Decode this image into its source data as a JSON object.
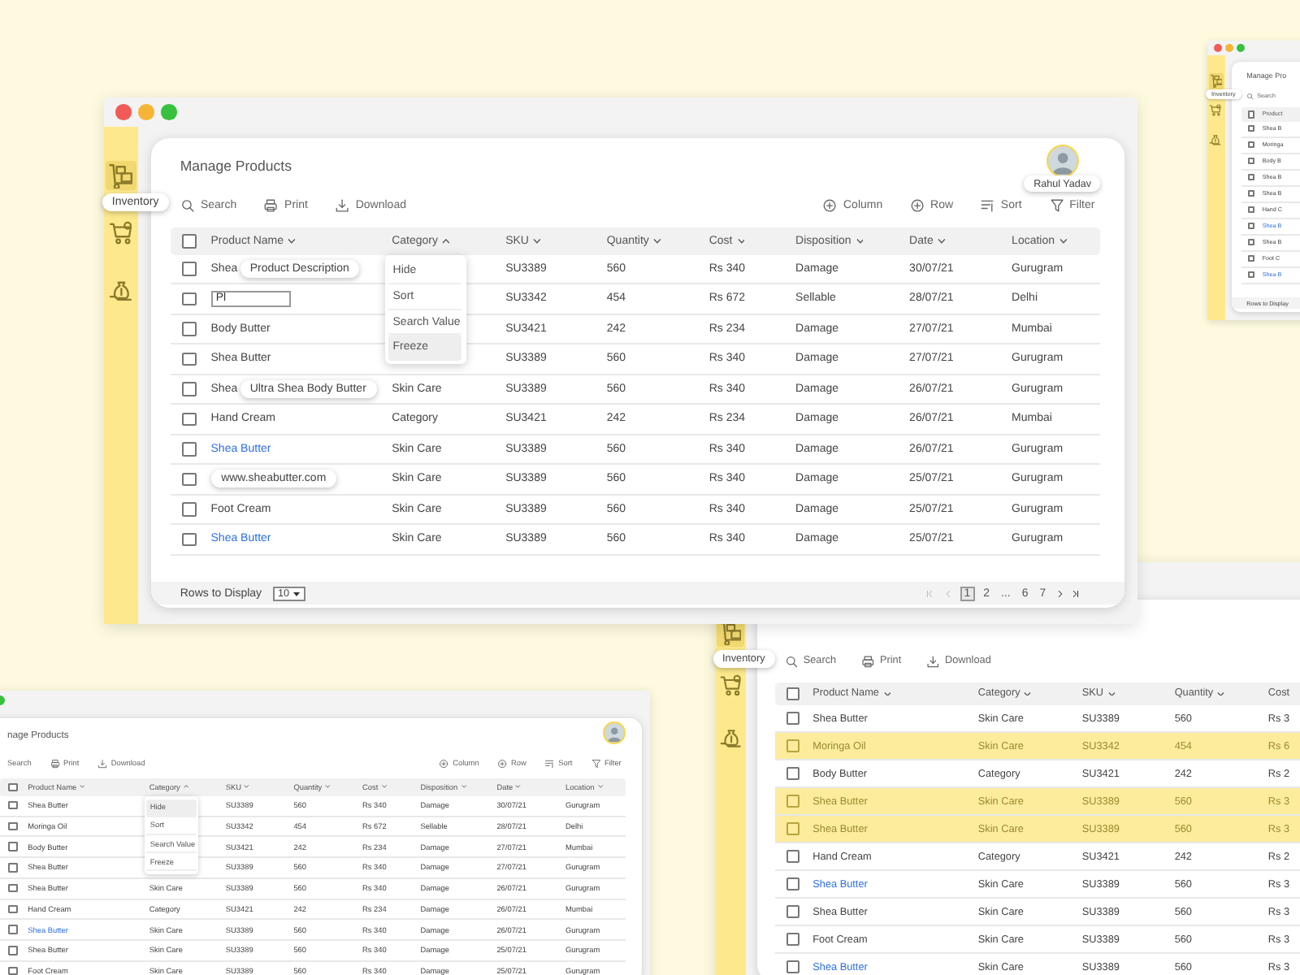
{
  "windows": [
    {
      "title": "Manage Products",
      "user_name": "Rahul Yadav",
      "header_checked": false,
      "sidebar": [
        {
          "kind": "boxes",
          "selected": true,
          "tooltip": "Inventory"
        },
        {
          "kind": "cart",
          "selected": false
        },
        {
          "kind": "money",
          "selected": false
        }
      ],
      "toolbar_left": [
        {
          "kind": "search",
          "label": "Search"
        },
        {
          "kind": "print",
          "label": "Print"
        },
        {
          "kind": "download",
          "label": "Download"
        }
      ],
      "toolbar_right": [
        {
          "kind": "column",
          "label": "Column"
        },
        {
          "kind": "row",
          "label": "Row"
        },
        {
          "kind": "sort",
          "label": "Sort"
        },
        {
          "kind": "filter",
          "label": "Filter"
        }
      ],
      "columns": [
        {
          "label": "Product Name",
          "ascending": false
        },
        {
          "label": "Category",
          "ascending": true
        },
        {
          "label": "SKU",
          "ascending": false
        },
        {
          "label": "Quantity",
          "ascending": false
        },
        {
          "label": "Cost",
          "ascending": false
        },
        {
          "label": "Disposition",
          "ascending": false
        },
        {
          "label": "Date",
          "ascending": false
        },
        {
          "label": "Location",
          "ascending": false
        }
      ],
      "menu": {
        "items": [
          {
            "label": "Hide",
            "selected": false
          },
          {
            "label": "Sort",
            "selected": false
          },
          {
            "label": "Search Value",
            "selected": false
          },
          {
            "label": "Freeze",
            "selected": true
          }
        ]
      },
      "rows": [
        {
          "selected": false,
          "product": {
            "kind": "text",
            "text": "Shea",
            "tooltip": "Product Description"
          },
          "sku": "SU3389",
          "quantity": "560",
          "cost": "Rs 340",
          "disposition": "Damage",
          "date": "30/07/21",
          "location": "Gurugram"
        },
        {
          "selected": false,
          "product": {
            "kind": "field",
            "value": "Pl"
          },
          "sku": "SU3342",
          "quantity": "454",
          "cost": "Rs 672",
          "disposition": "Sellable",
          "date": "28/07/21",
          "location": "Delhi"
        },
        {
          "selected": false,
          "product": {
            "kind": "text",
            "text": "Body Butter"
          },
          "sku": "SU3421",
          "quantity": "242",
          "cost": "Rs 234",
          "disposition": "Damage",
          "date": "27/07/21",
          "location": "Mumbai"
        },
        {
          "selected": false,
          "product": {
            "kind": "text",
            "text": "Shea Butter"
          },
          "sku": "SU3389",
          "quantity": "560",
          "cost": "Rs 340",
          "disposition": "Damage",
          "date": "27/07/21",
          "location": "Gurugram"
        },
        {
          "selected": false,
          "product": {
            "kind": "text",
            "text": "Shea",
            "tooltip": "Ultra Shea Body Butter"
          },
          "category": "Skin Care",
          "sku": "SU3389",
          "quantity": "560",
          "cost": "Rs 340",
          "disposition": "Damage",
          "date": "26/07/21",
          "location": "Gurugram"
        },
        {
          "selected": false,
          "product": {
            "kind": "text",
            "text": "Hand Cream"
          },
          "category": "Category",
          "sku": "SU3421",
          "quantity": "242",
          "cost": "Rs 234",
          "disposition": "Damage",
          "date": "26/07/21",
          "location": "Mumbai"
        },
        {
          "selected": false,
          "product": {
            "kind": "text",
            "text": "Shea Butter",
            "link": true
          },
          "category": "Skin Care",
          "sku": "SU3389",
          "quantity": "560",
          "cost": "Rs 340",
          "disposition": "Damage",
          "date": "26/07/21",
          "location": "Gurugram"
        },
        {
          "selected": false,
          "product": {
            "kind": "text",
            "tooltip": "www.sheabutter.com"
          },
          "category": "Skin Care",
          "sku": "SU3389",
          "quantity": "560",
          "cost": "Rs 340",
          "disposition": "Damage",
          "date": "25/07/21",
          "location": "Gurugram"
        },
        {
          "selected": false,
          "product": {
            "kind": "text",
            "text": "Foot Cream"
          },
          "category": "Skin Care",
          "sku": "SU3389",
          "quantity": "560",
          "cost": "Rs 340",
          "disposition": "Damage",
          "date": "25/07/21",
          "location": "Gurugram"
        },
        {
          "selected": false,
          "product": {
            "kind": "text",
            "text": "Shea Butter",
            "link": true
          },
          "category": "Skin Care",
          "sku": "SU3389",
          "quantity": "560",
          "cost": "Rs 340",
          "disposition": "Damage",
          "date": "25/07/21",
          "location": "Gurugram"
        }
      ],
      "footer": {
        "rows_label": "Rows to Display",
        "rows_value": "10",
        "pages": [
          {
            "label": "1",
            "selected": true
          },
          {
            "label": "2",
            "selected": false
          },
          {
            "label": "...",
            "selected": false
          },
          {
            "label": "6",
            "selected": false
          },
          {
            "label": "7",
            "selected": false
          }
        ]
      }
    },
    {
      "title": "Manage Pro",
      "header_checked": false,
      "sidebar": [
        {
          "kind": "boxes",
          "selected": true,
          "tooltip": "Inventory"
        },
        {
          "kind": "cart",
          "selected": false
        },
        {
          "kind": "money",
          "selected": false
        }
      ],
      "toolbar_left": [
        {
          "kind": "search",
          "label": "Search"
        }
      ],
      "columns": [
        {
          "label": "Product"
        }
      ],
      "rows": [
        {
          "selected": false,
          "product": {
            "kind": "text",
            "text": "Shea B"
          }
        },
        {
          "selected": false,
          "product": {
            "kind": "text",
            "text": "Moringa"
          }
        },
        {
          "selected": false,
          "product": {
            "kind": "text",
            "text": "Body B"
          }
        },
        {
          "selected": false,
          "product": {
            "kind": "text",
            "text": "Shea B"
          }
        },
        {
          "selected": false,
          "product": {
            "kind": "text",
            "text": "Shea B"
          }
        },
        {
          "selected": false,
          "product": {
            "kind": "text",
            "text": "Hand C"
          }
        },
        {
          "selected": false,
          "product": {
            "kind": "text",
            "text": "Shea B",
            "link": true
          }
        },
        {
          "selected": false,
          "product": {
            "kind": "text",
            "text": "Shea B"
          }
        },
        {
          "selected": false,
          "product": {
            "kind": "text",
            "text": "Foot C"
          }
        },
        {
          "selected": false,
          "product": {
            "kind": "text",
            "text": "Shea B",
            "link": true
          }
        }
      ],
      "footer": {
        "rows_label": "Rows to Display"
      }
    },
    {
      "title": "nage Products",
      "header_checked": false,
      "toolbar_left": [
        {
          "kind": "plain",
          "label": "Search"
        },
        {
          "kind": "print",
          "label": "Print"
        },
        {
          "kind": "download",
          "label": "Download"
        }
      ],
      "toolbar_right": [
        {
          "kind": "column",
          "label": "Column"
        },
        {
          "kind": "row",
          "label": "Row"
        },
        {
          "kind": "sort",
          "label": "Sort"
        },
        {
          "kind": "filter",
          "label": "Filter"
        }
      ],
      "columns": [
        {
          "label": "Product Name",
          "ascending": false
        },
        {
          "label": "Category",
          "ascending": true
        },
        {
          "label": "SKU",
          "ascending": false
        },
        {
          "label": "Quantity",
          "ascending": false
        },
        {
          "label": "Cost",
          "ascending": false
        },
        {
          "label": "Disposition",
          "ascending": false
        },
        {
          "label": "Date",
          "ascending": false
        },
        {
          "label": "Location",
          "ascending": false
        }
      ],
      "menu": {
        "items": [
          {
            "label": "Hide",
            "selected": true
          },
          {
            "label": "Sort",
            "selected": false
          },
          {
            "label": "Search Value",
            "selected": false
          },
          {
            "label": "Freeze",
            "selected": false
          }
        ]
      },
      "rows": [
        {
          "selected": false,
          "product": {
            "kind": "text",
            "text": "Shea Butter"
          },
          "sku": "SU3389",
          "quantity": "560",
          "cost": "Rs 340",
          "disposition": "Damage",
          "date": "30/07/21",
          "location": "Gurugram"
        },
        {
          "selected": false,
          "product": {
            "kind": "text",
            "text": "Moringa Oil"
          },
          "sku": "SU3342",
          "quantity": "454",
          "cost": "Rs 672",
          "disposition": "Sellable",
          "date": "28/07/21",
          "location": "Delhi"
        },
        {
          "selected": false,
          "product": {
            "kind": "text",
            "text": "Body Butter"
          },
          "sku": "SU3421",
          "quantity": "242",
          "cost": "Rs 234",
          "disposition": "Damage",
          "date": "27/07/21",
          "location": "Mumbai"
        },
        {
          "selected": false,
          "product": {
            "kind": "text",
            "text": "Shea Butter"
          },
          "sku": "SU3389",
          "quantity": "560",
          "cost": "Rs 340",
          "disposition": "Damage",
          "date": "27/07/21",
          "location": "Gurugram"
        },
        {
          "selected": false,
          "product": {
            "kind": "text",
            "text": "Shea Butter"
          },
          "category": "Skin Care",
          "sku": "SU3389",
          "quantity": "560",
          "cost": "Rs 340",
          "disposition": "Damage",
          "date": "26/07/21",
          "location": "Gurugram"
        },
        {
          "selected": false,
          "product": {
            "kind": "text",
            "text": "Hand Cream"
          },
          "category": "Category",
          "sku": "SU3421",
          "quantity": "242",
          "cost": "Rs 234",
          "disposition": "Damage",
          "date": "26/07/21",
          "location": "Mumbai"
        },
        {
          "selected": false,
          "product": {
            "kind": "text",
            "text": "Shea Butter",
            "link": true
          },
          "category": "Skin Care",
          "sku": "SU3389",
          "quantity": "560",
          "cost": "Rs 340",
          "disposition": "Damage",
          "date": "26/07/21",
          "location": "Gurugram"
        },
        {
          "selected": false,
          "product": {
            "kind": "text",
            "text": "Shea Butter"
          },
          "category": "Skin Care",
          "sku": "SU3389",
          "quantity": "560",
          "cost": "Rs 340",
          "disposition": "Damage",
          "date": "25/07/21",
          "location": "Gurugram"
        },
        {
          "selected": false,
          "product": {
            "kind": "text",
            "text": "Foot Cream"
          },
          "category": "Skin Care",
          "sku": "SU3389",
          "quantity": "560",
          "cost": "Rs 340",
          "disposition": "Damage",
          "date": "25/07/21",
          "location": "Gurugram"
        }
      ]
    },
    {
      "header_checked": false,
      "sidebar": [
        {
          "kind": "boxes",
          "selected": true,
          "tooltip": "Inventory"
        },
        {
          "kind": "cart",
          "selected": false
        },
        {
          "kind": "money",
          "selected": false
        }
      ],
      "toolbar_left": [
        {
          "kind": "search",
          "label": "Search"
        },
        {
          "kind": "print",
          "label": "Print"
        },
        {
          "kind": "download",
          "label": "Download"
        }
      ],
      "columns": [
        {
          "label": "Product Name",
          "ascending": false
        },
        {
          "label": "Category",
          "ascending": false
        },
        {
          "label": "SKU",
          "ascending": false
        },
        {
          "label": "Quantity",
          "ascending": false
        },
        {
          "label": "Cost"
        }
      ],
      "rows": [
        {
          "selected": false,
          "product": {
            "kind": "text",
            "text": "Shea Butter"
          },
          "category": "Skin Care",
          "sku": "SU3389",
          "quantity": "560",
          "cost": "Rs 3"
        },
        {
          "selected": true,
          "product": {
            "kind": "text",
            "text": "Moringa Oil"
          },
          "category": "Skin Care",
          "sku": "SU3342",
          "quantity": "454",
          "cost": "Rs 6"
        },
        {
          "selected": false,
          "product": {
            "kind": "text",
            "text": "Body Butter"
          },
          "category": "Category",
          "sku": "SU3421",
          "quantity": "242",
          "cost": "Rs 2"
        },
        {
          "selected": true,
          "product": {
            "kind": "text",
            "text": "Shea Butter"
          },
          "category": "Skin Care",
          "sku": "SU3389",
          "quantity": "560",
          "cost": "Rs 3"
        },
        {
          "selected": true,
          "product": {
            "kind": "text",
            "text": "Shea Butter"
          },
          "category": "Skin Care",
          "sku": "SU3389",
          "quantity": "560",
          "cost": "Rs 3"
        },
        {
          "selected": false,
          "product": {
            "kind": "text",
            "text": "Hand Cream"
          },
          "category": "Category",
          "sku": "SU3421",
          "quantity": "242",
          "cost": "Rs 2"
        },
        {
          "selected": false,
          "product": {
            "kind": "text",
            "text": "Shea Butter",
            "link": true
          },
          "category": "Skin Care",
          "sku": "SU3389",
          "quantity": "560",
          "cost": "Rs 3"
        },
        {
          "selected": false,
          "product": {
            "kind": "text",
            "text": "Shea Butter"
          },
          "category": "Skin Care",
          "sku": "SU3389",
          "quantity": "560",
          "cost": "Rs 3"
        },
        {
          "selected": false,
          "product": {
            "kind": "text",
            "text": "Foot Cream"
          },
          "category": "Skin Care",
          "sku": "SU3389",
          "quantity": "560",
          "cost": "Rs 3"
        },
        {
          "selected": false,
          "product": {
            "kind": "text",
            "text": "Shea Butter",
            "link": true
          },
          "category": "Skin Care",
          "sku": "SU3389",
          "quantity": "560",
          "cost": "Rs 3"
        }
      ]
    }
  ]
}
